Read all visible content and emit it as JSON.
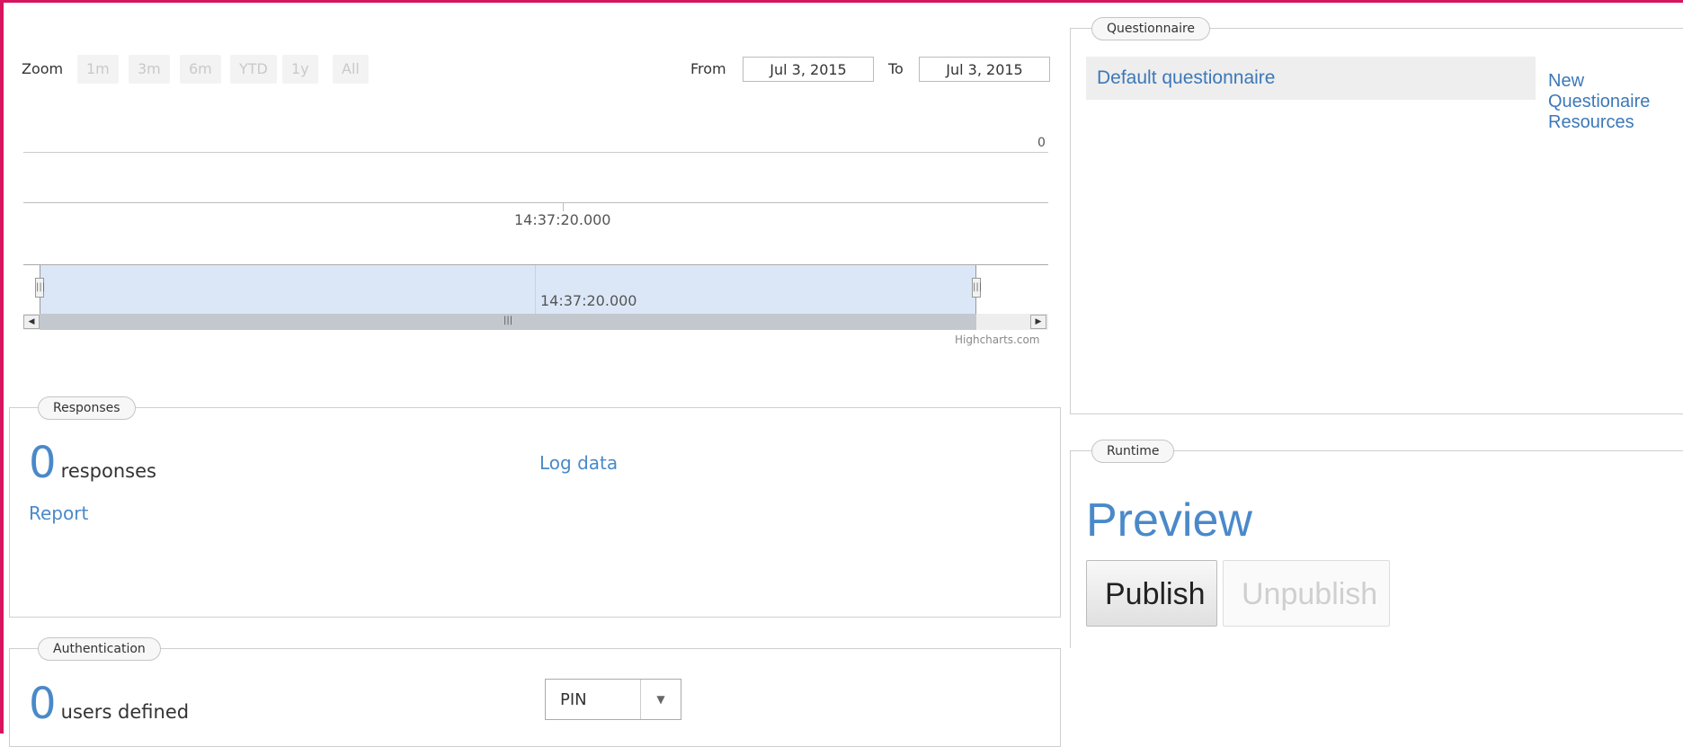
{
  "chart": {
    "zoom_label": "Zoom",
    "zoom_buttons": [
      "1m",
      "3m",
      "6m",
      "YTD",
      "1y",
      "All"
    ],
    "from_label": "From",
    "from_value": "Jul 3, 2015",
    "to_label": "To",
    "to_value": "Jul 3, 2015",
    "y_tick": "0",
    "x_tick": "14:37:20.000",
    "navigator_tick": "14:37:20.000",
    "credits": "Highcharts.com"
  },
  "responses": {
    "legend": "Responses",
    "count": "0",
    "count_suffix": "responses",
    "log_data": "Log data",
    "report": "Report"
  },
  "authentication": {
    "legend": "Authentication",
    "count": "0",
    "count_suffix": "users defined",
    "method_selected": "PIN"
  },
  "questionnaire": {
    "legend": "Questionnaire",
    "items": [
      "Default questionnaire"
    ],
    "new_link": "New Questionaire",
    "resources_link": "Resources"
  },
  "runtime": {
    "legend": "Runtime",
    "preview": "Preview",
    "publish": "Publish",
    "unpublish": "Unpublish"
  },
  "colors": {
    "frame": "#d6145f",
    "link": "#4a89c9",
    "navigator_fill": "#dbe7f7"
  }
}
